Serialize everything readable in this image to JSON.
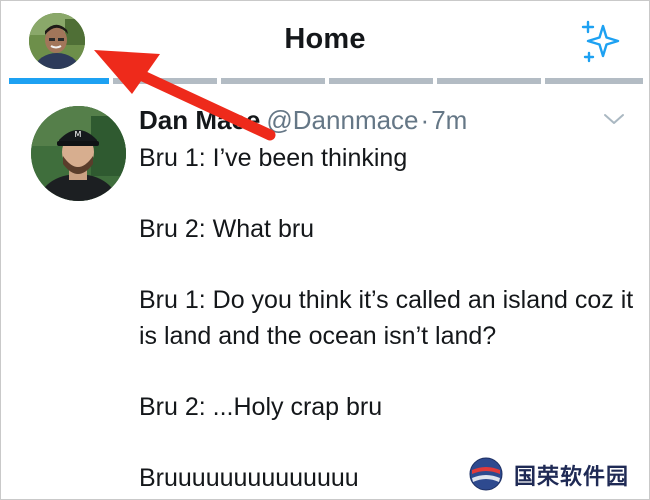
{
  "header": {
    "title": "Home",
    "avatar_icon": "profile-avatar-icon",
    "sparkle_icon": "sparkle-icon",
    "accent_color": "#1da1f2",
    "tab_count": 6,
    "active_tab_index": 0
  },
  "tweet": {
    "author_name": "Dan Mace",
    "handle": "@Dannmace",
    "separator": "·",
    "time": "7m",
    "lines": [
      "Bru 1: I’ve been thinking",
      "",
      "Bru 2: What bru",
      "",
      "Bru 1: Do you think it’s called an island coz it is land and the ocean isn’t land?",
      "",
      "Bru 2: ...Holy crap bru",
      "",
      "Bruuuuuuuuuuuuuu"
    ],
    "caret_icon": "chevron-down-icon"
  },
  "annotation": {
    "arrow_color": "#ee2a1b"
  },
  "watermark": {
    "text": "国荣软件园"
  }
}
